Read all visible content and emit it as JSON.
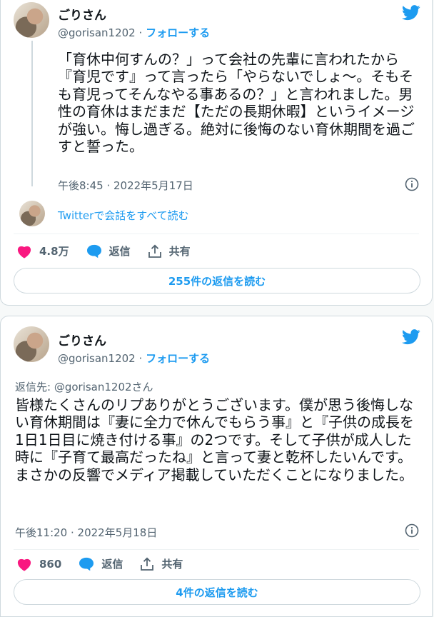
{
  "tweet1": {
    "display_name": "ごりさん",
    "handle": "@gorisan1202",
    "separator": "·",
    "follow_label": "フォローする",
    "text": "「育休中何すんの？」って会社の先輩に言われたから『育児です』って言ったら「やらないでしょ〜。そもそも育児ってそんなやる事あるの？」と言われました。男性の育休はまだまだ【ただの長期休暇】というイメージが強い。悔し過ぎる。絶対に後悔のない育休期間を過ごすと誓った。",
    "timestamp": "午後8:45 · 2022年5月17日",
    "thread_link": "Twitterで会話をすべて読む",
    "likes": "4.8万",
    "reply_label": "返信",
    "share_label": "共有",
    "read_replies": "255件の返信を読む"
  },
  "tweet2": {
    "display_name": "ごりさん",
    "handle": "@gorisan1202",
    "separator": "·",
    "follow_label": "フォローする",
    "replying_to": "返信先: @gorisan1202さん",
    "text": "皆様たくさんのリプありがとうございます。僕が思う後悔しない育休期間は『妻に全力で休んでもらう事』と『子供の成長を1日1日目に焼き付ける事』の2つです。そして子供が成人した時に『子育て最高だったね』と言って妻と乾杯したいんです。まさかの反響でメディア掲載していただくことになりました。",
    "timestamp": "午後11:20 · 2022年5月18日",
    "likes": "860",
    "reply_label": "返信",
    "share_label": "共有",
    "read_replies": "4件の返信を読む"
  },
  "colors": {
    "accent": "#1d9bf0",
    "like": "#f91880",
    "text": "#0f1419",
    "muted": "#536471",
    "border": "#cfd9de"
  },
  "icons": [
    "twitter-bird-icon",
    "info-icon",
    "heart-icon",
    "reply-bubble-icon",
    "share-icon"
  ]
}
